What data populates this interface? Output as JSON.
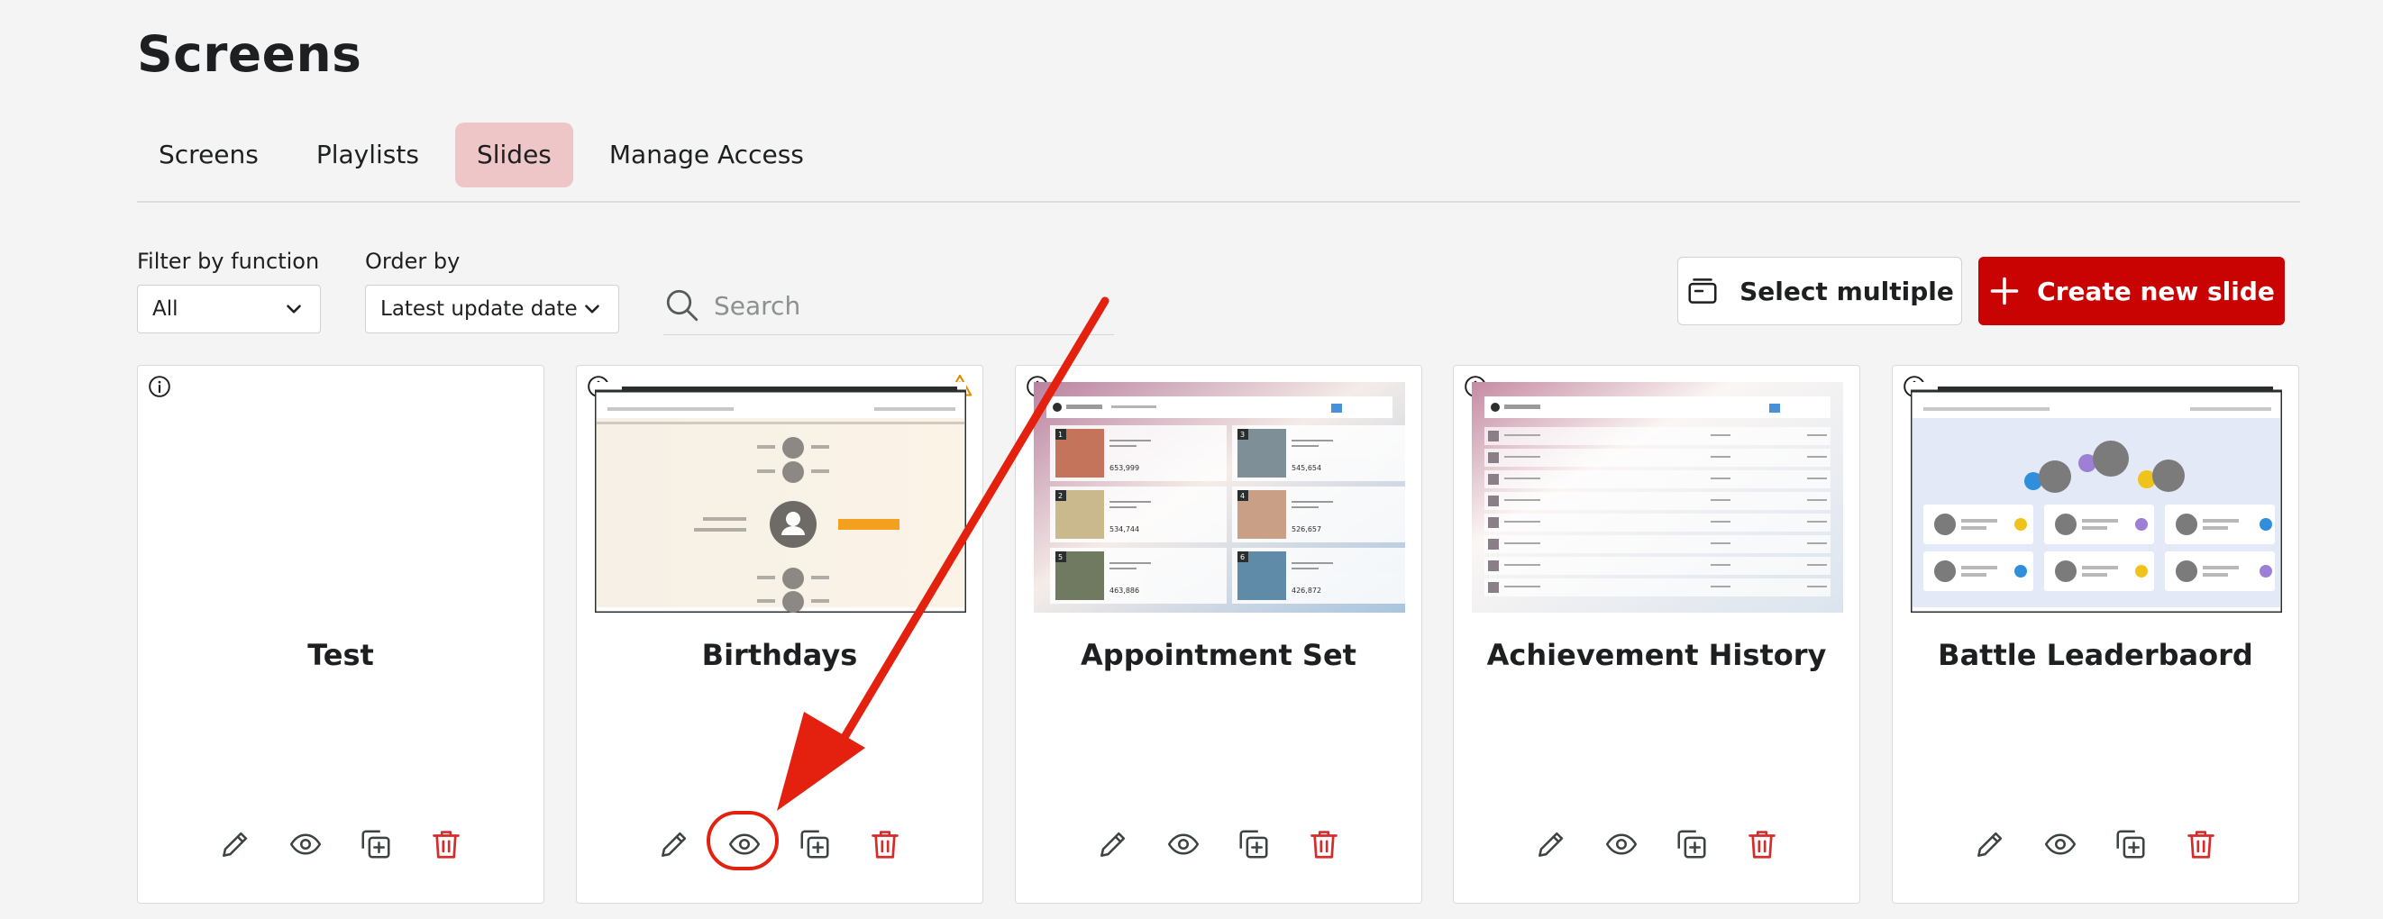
{
  "page": {
    "title": "Screens"
  },
  "tabs": [
    {
      "label": "Screens",
      "active": false
    },
    {
      "label": "Playlists",
      "active": false
    },
    {
      "label": "Slides",
      "active": true
    },
    {
      "label": "Manage Access",
      "active": false
    }
  ],
  "filters": {
    "function_label": "Filter by function",
    "function_value": "All",
    "order_label": "Order by",
    "order_value": "Latest update date"
  },
  "search": {
    "placeholder": "Search"
  },
  "toolbar": {
    "select_multiple_label": "Select multiple",
    "create_label": "Create new slide"
  },
  "slides": [
    {
      "title": "Test",
      "has_warning": false,
      "thumbnail": "blank"
    },
    {
      "title": "Birthdays",
      "has_warning": true,
      "thumbnail": "birthdays-preview"
    },
    {
      "title": "Appointment Set",
      "has_warning": false,
      "thumbnail": "leaderboard-grid-preview",
      "preview": {
        "ranks": [
          "1",
          "3",
          "2",
          "4",
          "5",
          "6"
        ],
        "values": [
          "653,999",
          "545,654",
          "534,744",
          "526,657",
          "463,886",
          "426,872"
        ]
      }
    },
    {
      "title": "Achievement History",
      "has_warning": false,
      "thumbnail": "table-list-preview"
    },
    {
      "title": "Battle Leaderbaord",
      "has_warning": false,
      "thumbnail": "battle-preview"
    }
  ],
  "colors": {
    "accent": "#c90202",
    "active_tab": "#efc6c7",
    "delete": "#d42b2b",
    "warning": "#e08a00",
    "annotation": "#e4210f"
  }
}
